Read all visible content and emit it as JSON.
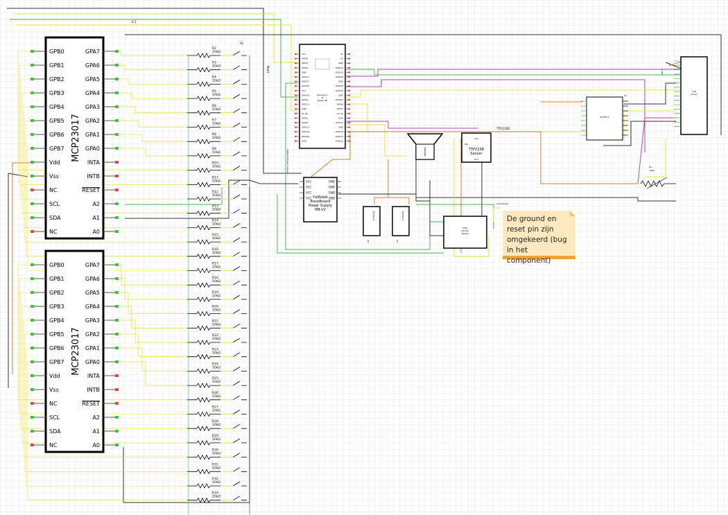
{
  "mcp1": {
    "title": "MCP23017",
    "left_pins": [
      "GPB0",
      "GPB1",
      "GPB2",
      "GPB3",
      "GPB4",
      "GPB5",
      "GPB6",
      "GPB7",
      "Vdd",
      "Vss",
      "NC",
      "SCL",
      "SDA",
      "NC"
    ],
    "right_pins": [
      "GPA7",
      "GPA6",
      "GPA5",
      "GPA4",
      "GPA3",
      "GPA2",
      "GPA1",
      "GPA0",
      "INTA",
      "INTB",
      "RESET",
      "A2",
      "A1",
      "A0"
    ]
  },
  "mcp2": {
    "title": "MCP23017",
    "left_pins": [
      "GPB0",
      "GPB1",
      "GPB2",
      "GPB3",
      "GPB4",
      "GPB5",
      "GPB6",
      "GPB7",
      "Vdd",
      "Vss",
      "NC",
      "SCL",
      "SDA",
      "NC"
    ],
    "right_pins": [
      "GPA7",
      "GPA6",
      "GPA5",
      "GPA4",
      "GPA3",
      "GPA2",
      "GPA1",
      "GPA0",
      "INTA",
      "INTB",
      "RESET",
      "A2",
      "A1",
      "A0"
    ]
  },
  "ic_label": "IC1",
  "resistors": [
    {
      "name": "R2",
      "value": "10kΩ"
    },
    {
      "name": "R3",
      "value": "10kΩ"
    },
    {
      "name": "R4",
      "value": "10kΩ"
    },
    {
      "name": "R5",
      "value": "10kΩ"
    },
    {
      "name": "R6",
      "value": "10kΩ"
    },
    {
      "name": "R7",
      "value": "10kΩ"
    },
    {
      "name": "R8",
      "value": "10kΩ"
    },
    {
      "name": "R9",
      "value": "10kΩ"
    },
    {
      "name": "R10",
      "value": "10kΩ"
    },
    {
      "name": "R11",
      "value": "10kΩ"
    },
    {
      "name": "R12",
      "value": "10kΩ"
    },
    {
      "name": "R13",
      "value": "10kΩ"
    },
    {
      "name": "R14",
      "value": "10kΩ"
    },
    {
      "name": "R15",
      "value": "10kΩ"
    },
    {
      "name": "R16",
      "value": "10kΩ"
    },
    {
      "name": "R17",
      "value": "10kΩ"
    },
    {
      "name": "R18",
      "value": "10kΩ"
    },
    {
      "name": "R19",
      "value": "10kΩ"
    },
    {
      "name": "R20",
      "value": "10kΩ"
    },
    {
      "name": "R21",
      "value": "10kΩ"
    },
    {
      "name": "R22",
      "value": "10kΩ"
    },
    {
      "name": "R23",
      "value": "10kΩ"
    },
    {
      "name": "R24",
      "value": "10kΩ"
    },
    {
      "name": "R25",
      "value": "10kΩ"
    },
    {
      "name": "R26",
      "value": "10kΩ"
    },
    {
      "name": "R27",
      "value": "10kΩ"
    },
    {
      "name": "R28",
      "value": "10kΩ"
    },
    {
      "name": "R29",
      "value": "10kΩ"
    },
    {
      "name": "R30",
      "value": "10kΩ"
    },
    {
      "name": "R31",
      "value": "10kΩ"
    },
    {
      "name": "R32",
      "value": "10kΩ"
    },
    {
      "name": "R33",
      "value": "10kΩ"
    }
  ],
  "switch_label": "S1",
  "raspberry_pi": {
    "title_lines": [
      "Raspberry",
      "Pi",
      "Model 3B"
    ],
    "label": "Mod1",
    "left_pins": [
      "3V3",
      "GPIO2",
      "GPIO3",
      "GPIO4",
      "GND",
      "GPIO17",
      "GPIO27",
      "GPIO22",
      "3V3",
      "GPIO10",
      "GPIO9",
      "GPIO11",
      "GND",
      "ID_SD",
      "GPIO5",
      "GPIO6",
      "GPIO13",
      "GPIO19",
      "GPIO26",
      "GND"
    ],
    "right_pins": [
      "5V",
      "5V",
      "GND",
      "GPIO14",
      "GPIO15",
      "GPIO18",
      "GND",
      "GPIO23",
      "GPIO24",
      "GND",
      "GPIO25",
      "GPIO8",
      "GPIO7",
      "ID_SC",
      "GND",
      "GPIO12",
      "GND",
      "GPIO16",
      "GPIO20",
      "GPIO21"
    ]
  },
  "power_supply": {
    "title_lines": [
      "YwRobot",
      "Breadboard",
      "Power Supply",
      "MB-V2"
    ],
    "left_pins": [
      "VCC",
      "VCC",
      "VCC",
      "VCC"
    ],
    "right_pins": [
      "GND",
      "GND",
      "GND",
      "GND"
    ],
    "side_label": "YwRobot Power Supply1"
  },
  "speaker": {
    "label": "SPEAKER"
  },
  "ttp": {
    "title_lines": [
      "TTP223B",
      "Sensor"
    ],
    "pins": [
      "VCC",
      "SIG",
      "Gnd"
    ],
    "net_label": "TTP223B1"
  },
  "pir1": {
    "label": "PCF8574",
    "part": "U3"
  },
  "pir2": {
    "label": "PCF8574",
    "part": "U5"
  },
  "rfid": {
    "title_lines": [
      "RFID",
      "RC522",
      "Reader"
    ],
    "net_label": "Onderdeel1"
  },
  "pcf": {
    "label": "PCF8574",
    "part": "U2"
  },
  "lcd": {
    "title_lines": [
      "LCD",
      "screen"
    ],
    "part": "LCD1"
  },
  "pot": {
    "name": "R1",
    "value": "10kΩ"
  },
  "note": {
    "text": "De ground en reset pin zijn omgekeerd (bug in het component)"
  },
  "colors": {
    "grid": "#e3e3e3",
    "wire_yellow": "#e8e234",
    "wire_green": "#49b24a",
    "wire_orange": "#e07a1f",
    "wire_purple": "#b63fb6",
    "wire_black": "#303030",
    "pin_green": "#3ec23e",
    "pin_red": "#e04848",
    "note_bg": "#fde9bd",
    "note_border": "#f0a232"
  }
}
